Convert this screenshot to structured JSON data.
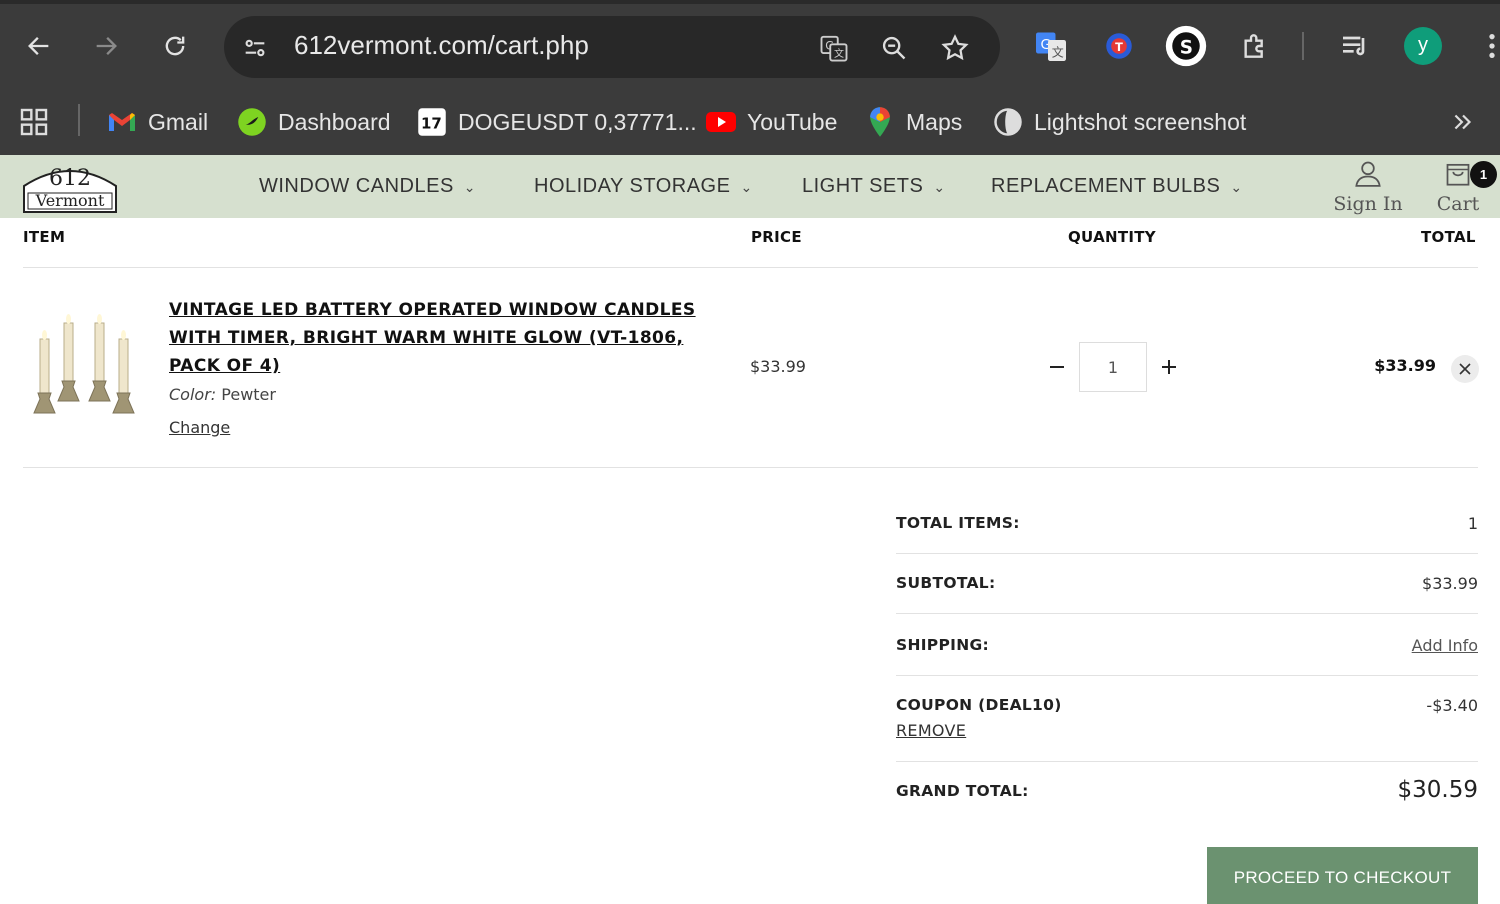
{
  "browser": {
    "url": "612vermont.com/cart.php",
    "bookmarks": [
      {
        "label": "Gmail",
        "icon": "gmail-icon"
      },
      {
        "label": "Dashboard",
        "icon": "dashboard-icon"
      },
      {
        "label": "DOGEUSDT 0,37771...",
        "icon": "tradingview-icon"
      },
      {
        "label": "YouTube",
        "icon": "youtube-icon"
      },
      {
        "label": "Maps",
        "icon": "maps-icon"
      },
      {
        "label": "Lightshot screenshot",
        "icon": "lightshot-icon"
      }
    ],
    "profile_initial": "y",
    "profile_color": "#0f9d7a"
  },
  "site": {
    "logo": {
      "number": "612",
      "word": "Vermont"
    },
    "menu": [
      {
        "label": "WINDOW CANDLES"
      },
      {
        "label": "HOLIDAY STORAGE"
      },
      {
        "label": "LIGHT SETS"
      },
      {
        "label": "REPLACEMENT BULBS"
      }
    ],
    "sign_in": "Sign In",
    "cart": "Cart",
    "cart_count": "1",
    "header_bg": "#d6e0cf"
  },
  "cart": {
    "headers": {
      "item": "ITEM",
      "price": "PRICE",
      "quantity": "QUANTITY",
      "total": "TOTAL"
    },
    "items": [
      {
        "title": "VINTAGE LED BATTERY OPERATED WINDOW CANDLES WITH TIMER, BRIGHT WARM WHITE GLOW (VT-1806, PACK OF 4)",
        "color_label": "Color:",
        "color_value": "Pewter",
        "change_label": "Change",
        "price": "$33.99",
        "quantity": "1",
        "total": "$33.99"
      }
    ]
  },
  "summary": {
    "total_items_label": "TOTAL ITEMS:",
    "total_items_value": "1",
    "subtotal_label": "SUBTOTAL:",
    "subtotal_value": "$33.99",
    "shipping_label": "SHIPPING:",
    "shipping_value": "Add Info",
    "coupon_label": "COUPON (DEAL10)",
    "coupon_value": "-$3.40",
    "coupon_remove": "REMOVE",
    "grand_total_label": "GRAND TOTAL:",
    "grand_total_value": "$30.59",
    "checkout_label": "PROCEED TO CHECKOUT",
    "checkout_color": "#6b9270"
  }
}
